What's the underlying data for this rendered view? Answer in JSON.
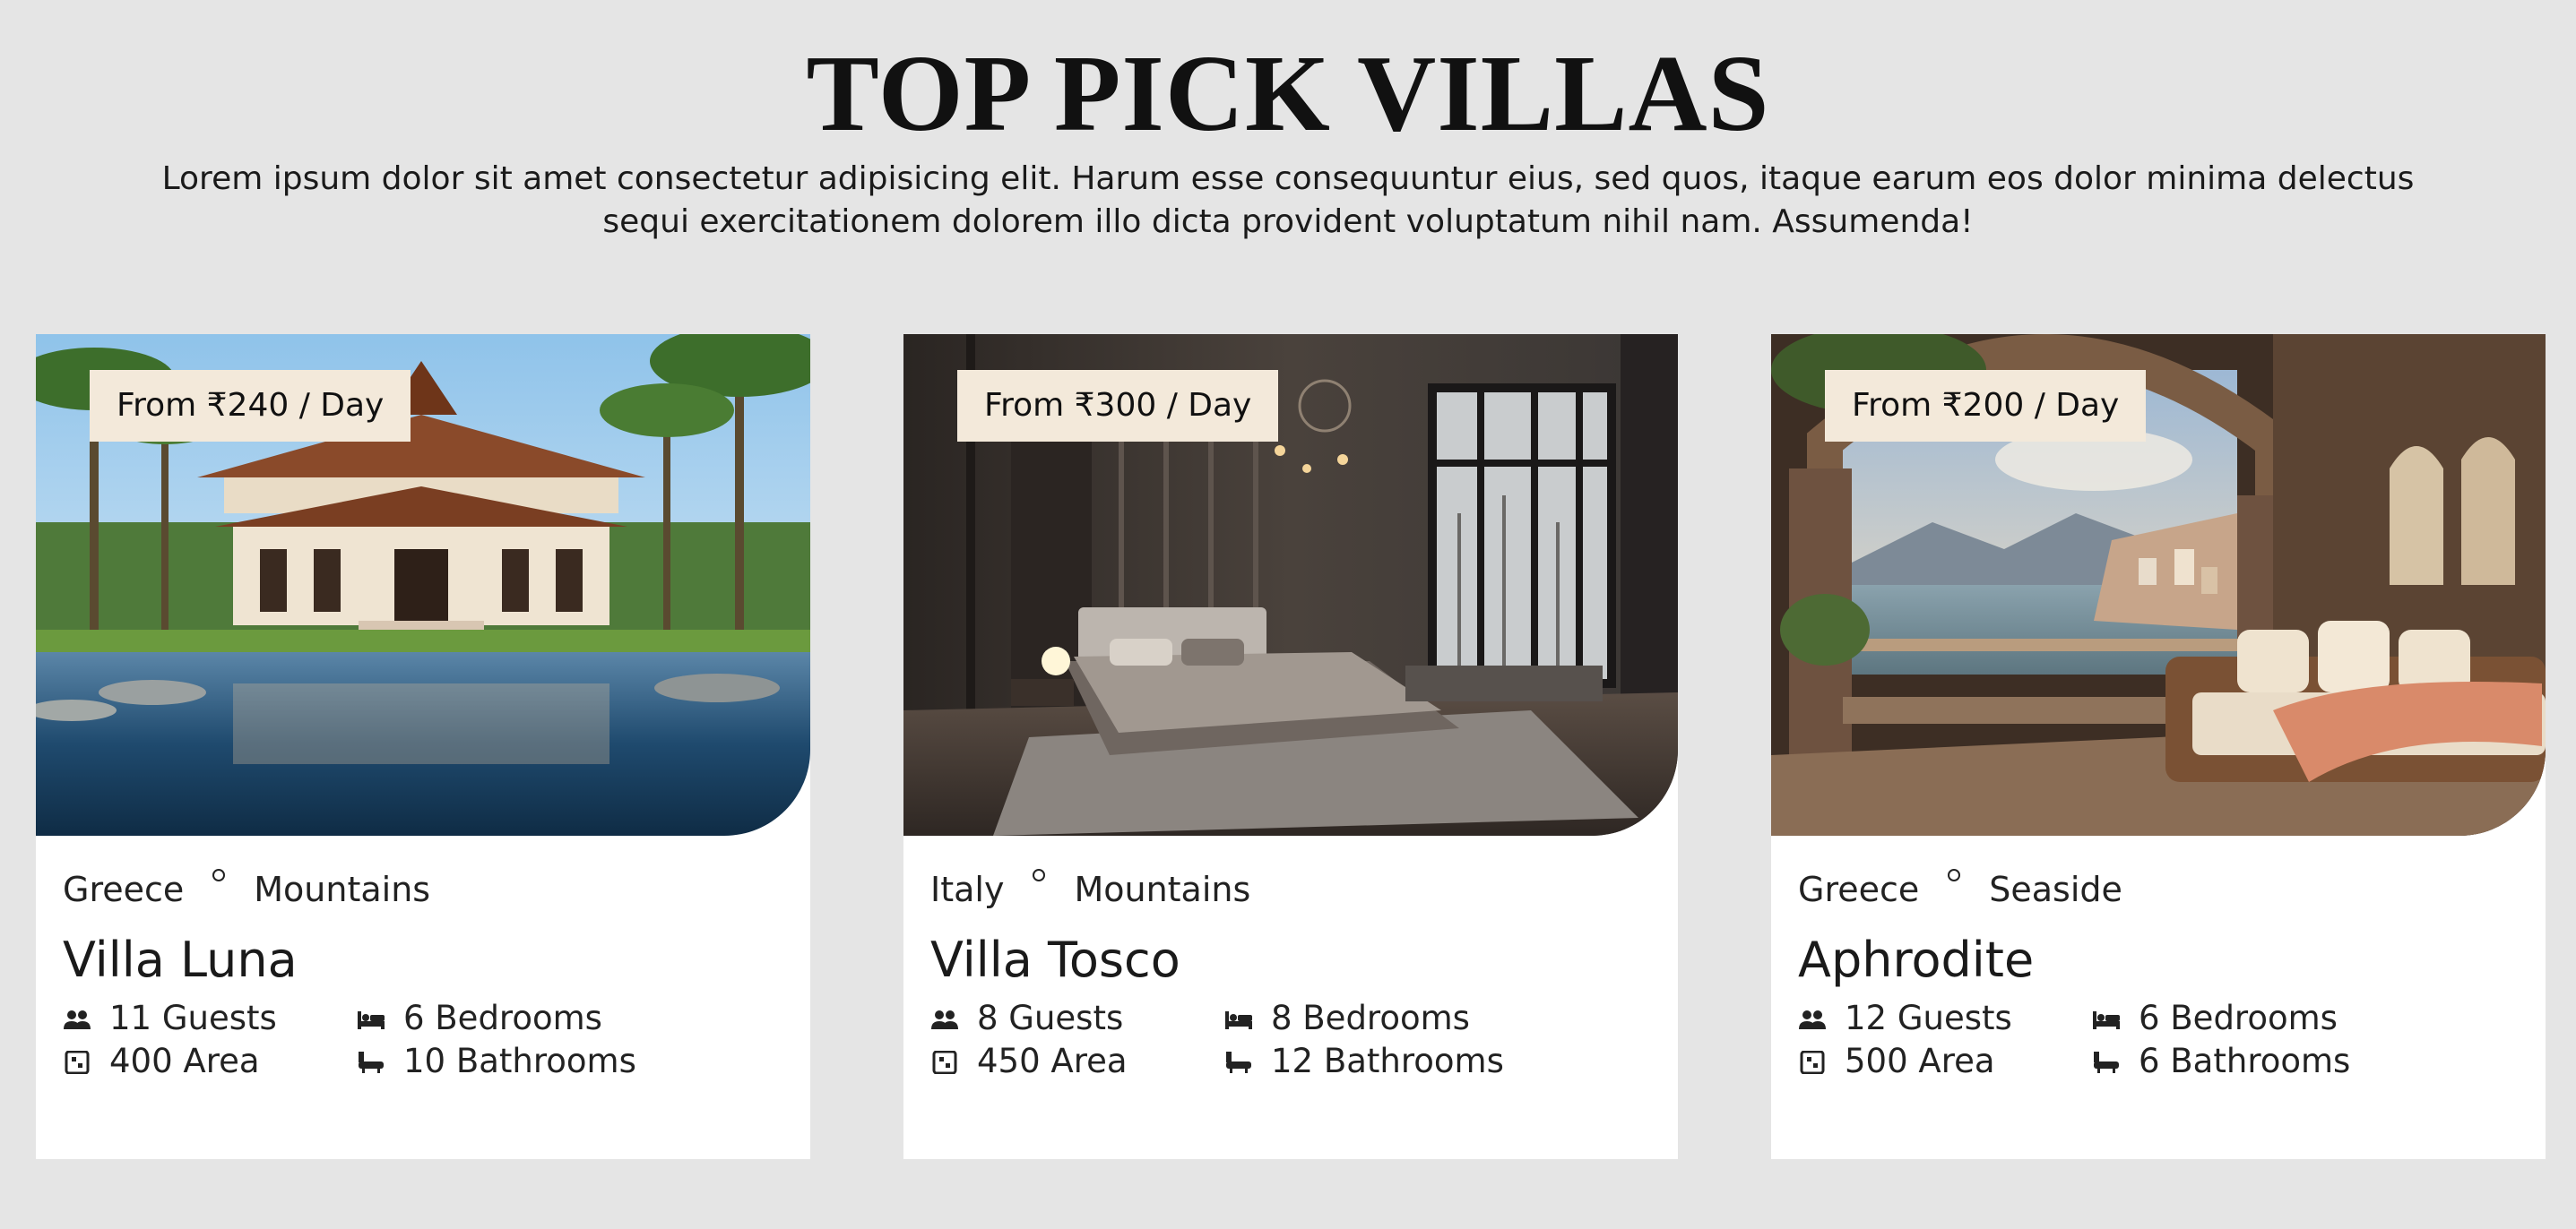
{
  "header": {
    "title": "TOP PICK VILLAS",
    "subtitle": "Lorem ipsum dolor sit amet consectetur adipisicing elit. Harum esse consequuntur eius, sed quos, itaque earum eos dolor minima delectus sequi exercitationem dolorem illo dicta provident voluptatum nihil nam. Assumenda!"
  },
  "colors": {
    "page_background": "#e5e5e5",
    "card_background": "#ffffff",
    "badge_background": "#f3e9da"
  },
  "icons": {
    "guests": "users-icon",
    "bedrooms": "bed-icon",
    "area": "area-icon",
    "bathrooms": "bath-icon"
  },
  "villas": [
    {
      "price": "From ₹240 / Day",
      "country": "Greece",
      "category": "Mountains",
      "name": "Villa Luna",
      "guests": "11 Guests",
      "bedrooms": "6 Bedrooms",
      "area": "400 Area",
      "bathrooms": "10 Bathrooms",
      "image": "tropical-villa-with-pool"
    },
    {
      "price": "From ₹300 / Day",
      "country": "Italy",
      "category": "Mountains",
      "name": "Villa Tosco",
      "guests": "8 Guests",
      "bedrooms": "8 Bedrooms",
      "area": "450 Area",
      "bathrooms": "12 Bathrooms",
      "image": "modern-bedroom-with-snow-view"
    },
    {
      "price": "From ₹200 / Day",
      "country": "Greece",
      "category": "Seaside",
      "name": "Aphrodite",
      "guests": "12 Guests",
      "bedrooms": "6 Bedrooms",
      "area": "500 Area",
      "bathrooms": "6 Bathrooms",
      "image": "seaside-terrace-with-sofa"
    }
  ]
}
